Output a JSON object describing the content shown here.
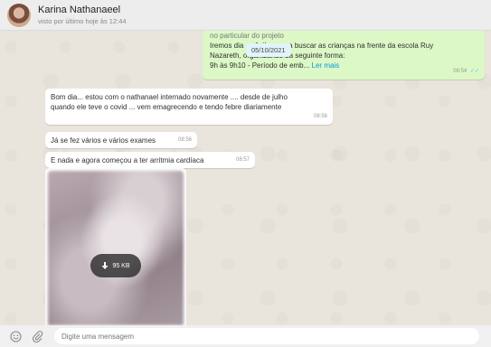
{
  "header": {
    "contact_name": "Karina Nathanaeel",
    "status": "visto por último hoje às 12:44"
  },
  "chat": {
    "date_chip": "05/10/2021",
    "outgoing": {
      "line1": "no particular do projeto",
      "line2": "Iremos dia … ônibus para buscar as crianças na frente da escola Ruy",
      "line3": "Nazareth, organizando da seguinte forma:",
      "line4": "9h às 9h10 - Período de emb...",
      "read_more": "Ler mais",
      "time": "08:54"
    },
    "messages": [
      {
        "text_line1": "Bom dia... estou com o nathanael internado novamente .... desde de julho",
        "text_line2": "quando ele teve o covid ... vem emagrecendo e tendo febre diariamente",
        "time": "08:56"
      },
      {
        "text": "Já se fez vários e vários exames",
        "time": "08:56"
      },
      {
        "text": "E nada e agora começou a ter arritmia cardíaca",
        "time": "08:57"
      }
    ],
    "media": {
      "size_label": "95 KB"
    }
  },
  "footer": {
    "placeholder": "Digite uma mensagem"
  }
}
